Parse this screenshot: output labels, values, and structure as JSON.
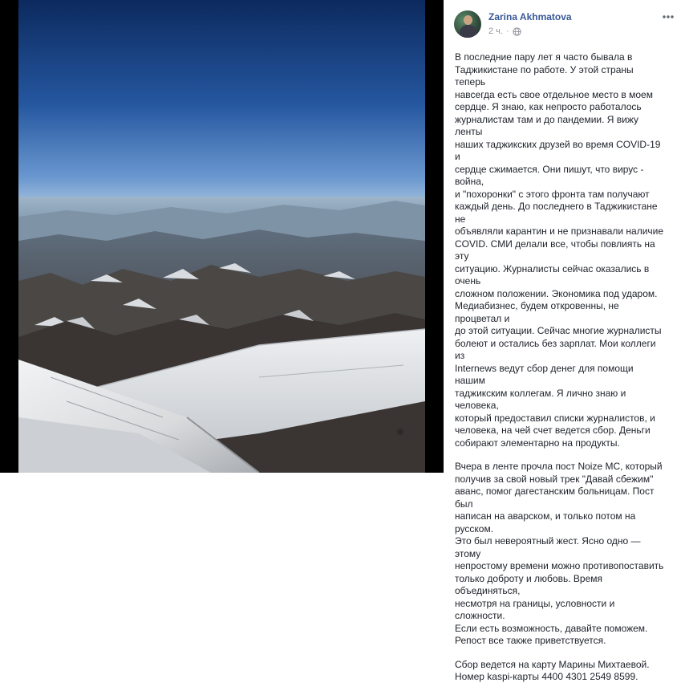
{
  "post": {
    "author": "Zarina Akhmatova",
    "time": "2 ч.",
    "separator": "·",
    "paragraphs": [
      "В последние пару лет я часто бывала в\nТаджикистане по работе. У этой страны теперь\nнавсегда есть свое отдельное место в моем\nсердце. Я знаю, как непросто работалось\nжурналистам там и до пандемии. Я вижу ленты\nнаших таджикских друзей во время COVID-19 и\nсердце сжимается. Они пишут, что вирус - война,\nи \"похоронки\" с этого фронта там получают\nкаждый день. До последнего в Таджикистане не\nобъявляли карантин и не признавали наличие\nCOVID. СМИ делали все, чтобы повлиять на эту\nситуацию. Журналисты сейчас оказались в очень\nсложном положении. Экономика под ударом.\nМедиабизнес, будем откровенны, не процветал и\nдо этой ситуации. Сейчас многие журналисты\nболеют и остались без зарплат. Мои коллеги из\nInternews ведут сбор денег для помощи нашим\nтаджикским коллегам. Я лично знаю и человека,\nкоторый предоставил списки журналистов, и\nчеловека, на чей счет ведется сбор. Деньги\nсобирают элементарно на продукты.",
      "Вчера в ленте прочла пост Noize MC, который\nполучив за свой новый трек \"Давай сбежим\"\nаванс, помог дагестанским больницам. Пост был\nнаписан на аварском, и только потом на русском.\nЭто был невероятный жест. Ясно одно — этому\nнепростому времени можно противопоставить\nтолько доброту и любовь. Время объединяться,\nнесмотря на границы, условности и сложности.\nЕсли есть возможность, давайте поможем.\nРепост все также приветствуется.",
      "Сбор ведется на карту Марины Михтаевой.\nНомер kaspi-карты 4400 4301 2549 8599."
    ]
  },
  "icons": {
    "privacy": "globe-icon",
    "options": "more-options-icon",
    "avatar": "avatar"
  },
  "colors": {
    "author_link": "#385898",
    "meta_text": "#90949c",
    "body_text": "#1d2129",
    "sky_top": "#0e2d63",
    "sky_bottom": "#5a87c4"
  }
}
